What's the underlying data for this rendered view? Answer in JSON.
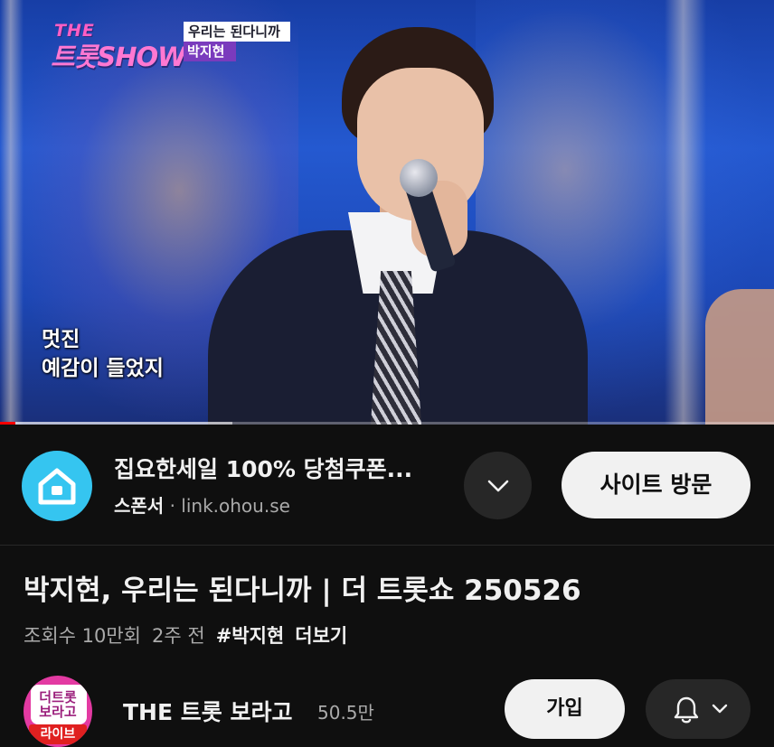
{
  "player": {
    "overlay": {
      "logo_top": "THE",
      "logo_main": "트롯SHOW",
      "song_title": "우리는 된다니까",
      "singer_name": "박지현"
    },
    "subtitle_lines": [
      "멋진",
      "예감이 들었지"
    ],
    "progress_fraction": 0.02,
    "buffered_fraction": 0.3
  },
  "ad": {
    "title": "집요한세일 100% 당첨쿠폰...",
    "sponsor_label": "스폰서",
    "separator": "·",
    "domain": "link.ohou.se",
    "cta_label": "사이트 방문",
    "logo_color": "#35c5f0"
  },
  "video": {
    "title": "박지현, 우리는 된다니까 | 더 트롯쇼 250526",
    "views": "조회수 10만회",
    "age": "2주 전",
    "hashtag": "#박지현",
    "more_label": "더보기"
  },
  "channel": {
    "avatar_text": "더트롯\n보라고",
    "avatar_badge": "라이브",
    "name": "THE 트롯 보라고",
    "subscribers": "50.5만",
    "join_label": "가입"
  },
  "colors": {
    "background": "#0f0f0f",
    "progress": "#ff0000",
    "button_light": "#f1f1f1",
    "button_dark": "#272727"
  }
}
